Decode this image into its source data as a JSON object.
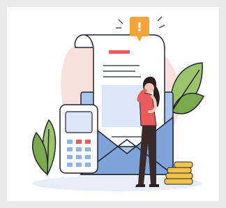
{
  "illustration": {
    "icons": {
      "alert": "exclamation-icon",
      "calculator": "payment-terminal-icon",
      "coins": "coin-stack-icon",
      "envelope": "envelope-icon",
      "invoice": "document-icon"
    },
    "colors": {
      "frame_bg": "#e9e9e9",
      "panel_bg": "#ffffff",
      "envelope": "#a9c4e8",
      "envelope_dark": "#7fa2d8",
      "paper": "#ffffff",
      "outline": "#1f2430",
      "alert": "#f2a33a",
      "blush": "#f8e1dc",
      "leaf": "#9bc46a",
      "leaf_dark": "#7aa84d",
      "shirt": "#e85b5b",
      "pants": "#3a2a2a",
      "hair": "#2b1f1f",
      "skin": "#f2c6b6",
      "coin": "#f3c34e",
      "button_red": "#e45b5b",
      "button_blue": "#8fb1e6",
      "shadow": "#e7eef8"
    },
    "alert_text": "!"
  }
}
